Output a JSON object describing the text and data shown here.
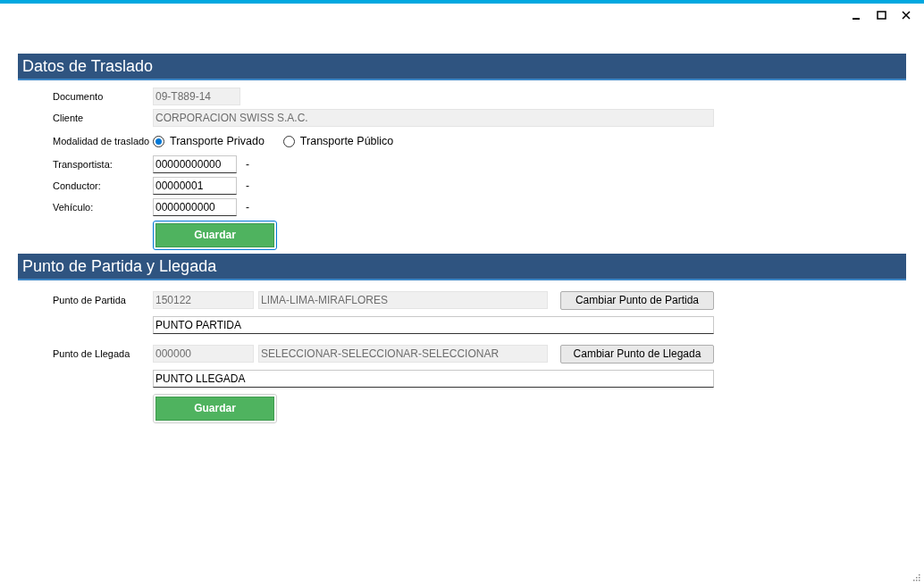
{
  "traslado": {
    "title": "Datos de Traslado",
    "documento": {
      "label": "Documento",
      "value": "09-T889-14"
    },
    "cliente": {
      "label": "Cliente",
      "value": "CORPORACION SWISS S.A.C."
    },
    "modalidad": {
      "label": "Modalidad de traslado",
      "options": [
        {
          "label": "Transporte Privado",
          "selected": true
        },
        {
          "label": "Transporte Público",
          "selected": false
        }
      ]
    },
    "fields": [
      {
        "label": "Transportista:",
        "value": "00000000000",
        "note": "-"
      },
      {
        "label": "Conductor:",
        "value": "00000001",
        "note": "-"
      },
      {
        "label": "Vehículo:",
        "value": "0000000000",
        "note": "-"
      }
    ],
    "save_button": {
      "label": "Guardar",
      "focused": true
    }
  },
  "puntos": {
    "title": "Punto de Partida y Llegada",
    "rows": [
      {
        "label": "Punto de Partida",
        "code": "150122",
        "location": "LIMA-LIMA-MIRAFLORES",
        "button": "Cambiar Punto de Partida",
        "address": "PUNTO PARTIDA"
      },
      {
        "label": "Punto de Llegada",
        "code": "000000",
        "location": "SELECCIONAR-SELECCIONAR-SELECCIONAR",
        "button": "Cambiar Punto de Llegada",
        "address": "PUNTO LLEGADA"
      }
    ],
    "save_button": {
      "label": "Guardar",
      "focused": false
    }
  }
}
